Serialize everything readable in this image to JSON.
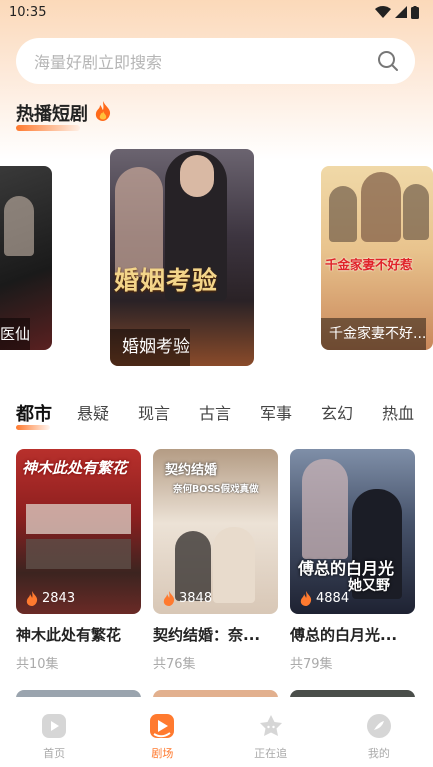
{
  "status_bar": {
    "time": "10:35"
  },
  "search": {
    "placeholder": "海量好剧立即搜索"
  },
  "hot_section": {
    "title": "热播短剧"
  },
  "carousel": [
    {
      "title": "医仙"
    },
    {
      "title": "婚姻考验",
      "poster_text": "婚姻考验"
    },
    {
      "title": "千金家妻不好...",
      "poster_text": "千金家妻不好惹"
    }
  ],
  "categories": [
    "都市",
    "悬疑",
    "现言",
    "古言",
    "军事",
    "玄幻",
    "热血"
  ],
  "active_category": "都市",
  "dramas": [
    {
      "title": "神木此处有繁花",
      "heat": "2843",
      "episodes": "共10集",
      "poster_text": "神木此处有繁花"
    },
    {
      "title": "契约结婚：奈...",
      "heat": "3848",
      "episodes": "共76集",
      "poster_text": "契约结婚",
      "poster_sub": "奈何BOSS假戏真做"
    },
    {
      "title": "傅总的白月光...",
      "heat": "4884",
      "episodes": "共79集",
      "poster_text": "傅总的白月光",
      "poster_sub": "她又野"
    }
  ],
  "bottom_nav": [
    {
      "label": "首页",
      "icon": "play-icon",
      "active": false
    },
    {
      "label": "剧场",
      "icon": "theater-icon",
      "active": true
    },
    {
      "label": "正在追",
      "icon": "star-icon",
      "active": false
    },
    {
      "label": "我的",
      "icon": "profile-icon",
      "active": false
    }
  ],
  "colors": {
    "accent": "#ff7a2f",
    "top_gradient": "#fbd9b9"
  }
}
